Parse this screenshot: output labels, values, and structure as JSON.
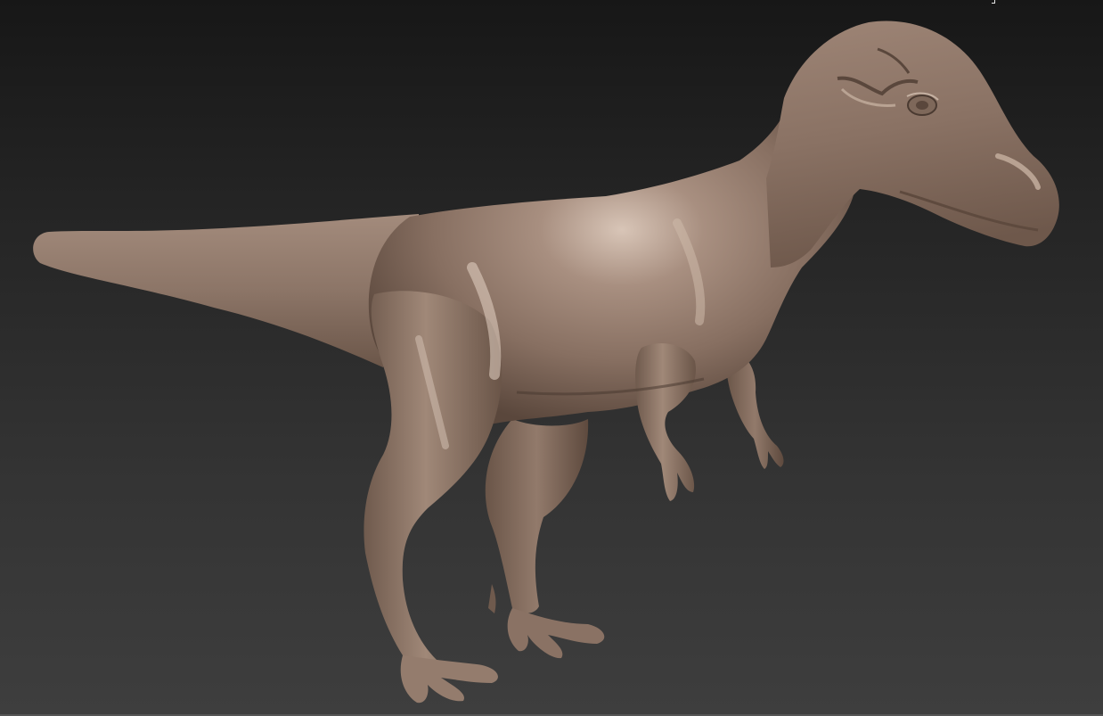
{
  "viewport": {
    "background_top": "#171717",
    "background_bottom": "#3e3e3e",
    "render_mode": "matcap"
  },
  "model": {
    "subject": "theropod-dinosaur",
    "material_color": "#8c7668",
    "highlight_color": "#d6c3b5",
    "shadow_color": "#4a3a31"
  }
}
